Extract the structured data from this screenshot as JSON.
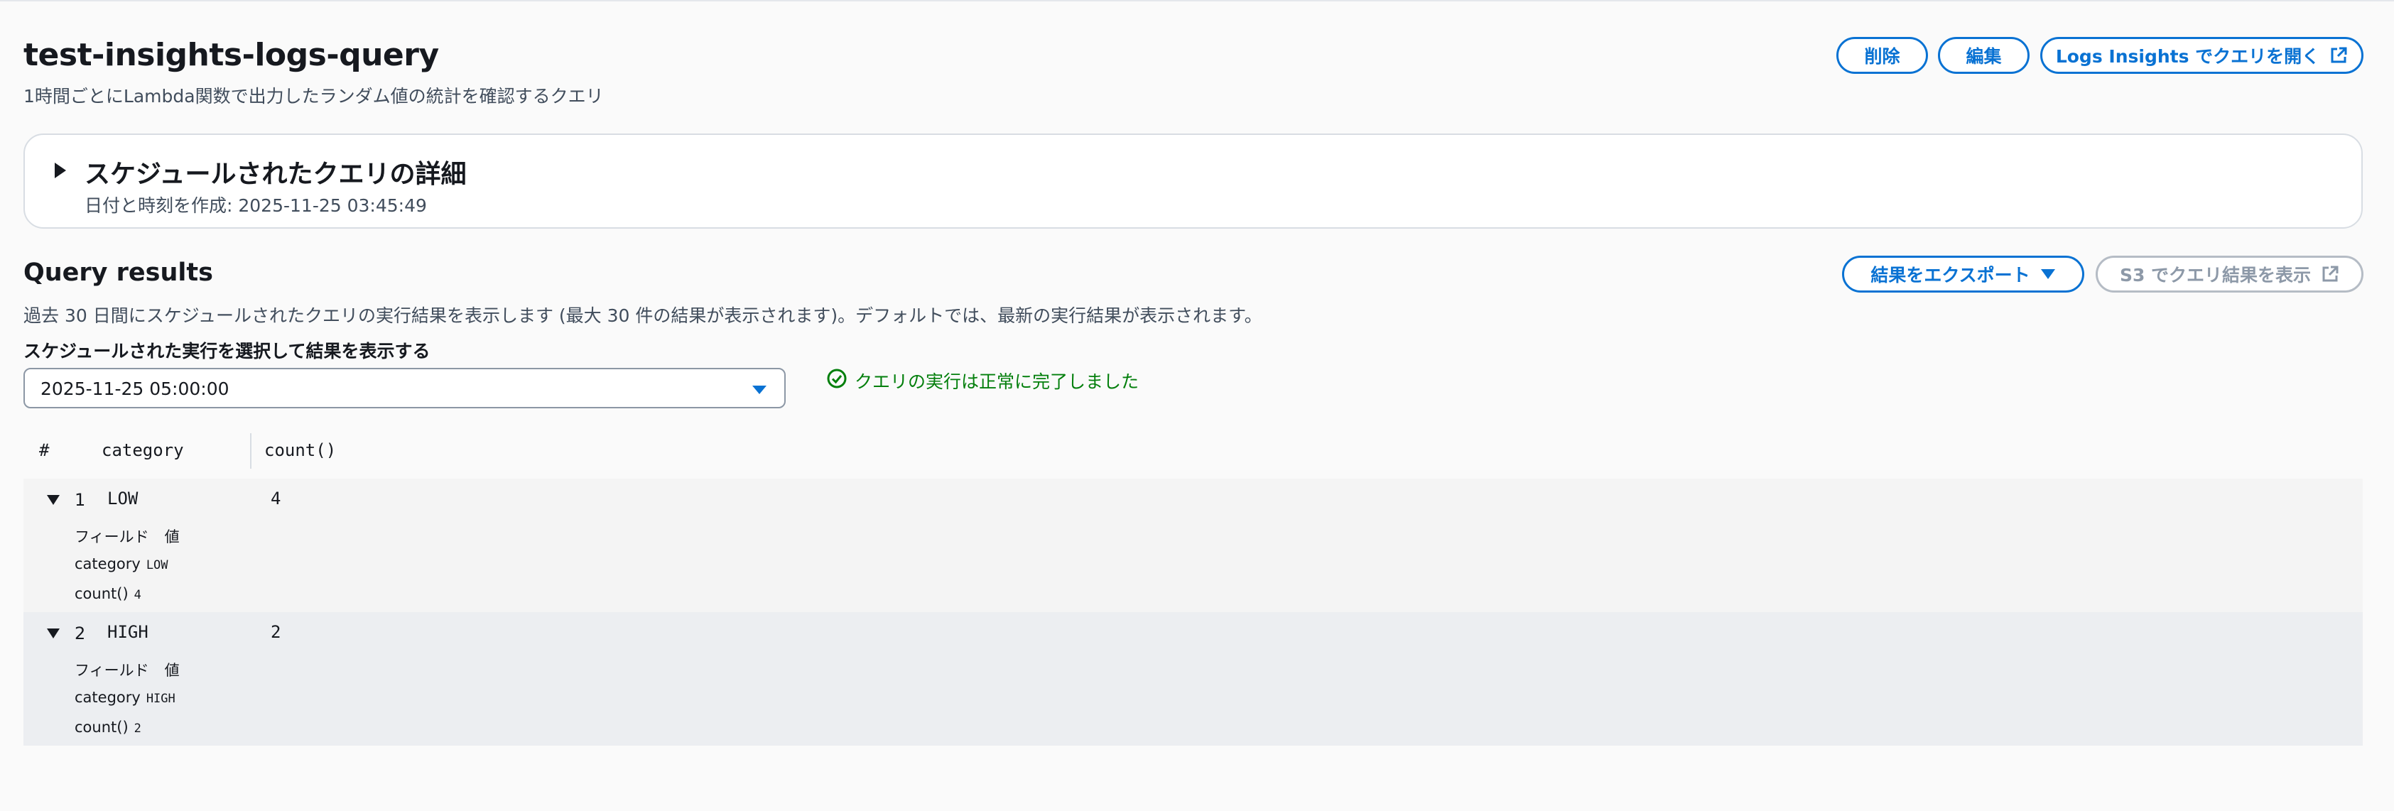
{
  "header": {
    "title": "test-insights-logs-query",
    "description": "1時間ごとにLambda関数で出力したランダム値の統計を確認するクエリ",
    "delete_label": "削除",
    "edit_label": "編集",
    "open_insights_label": "Logs Insights でクエリを開く"
  },
  "details": {
    "title": "スケジュールされたクエリの詳細",
    "created": "日付と時刻を作成: 2025-11-25 03:45:49"
  },
  "results": {
    "title": "Query results",
    "description": "過去 30 日間にスケジュールされたクエリの実行結果を表示します (最大 30 件の結果が表示されます)。デフォルトでは、最新の実行結果が表示されます。",
    "export_label": "結果をエクスポート",
    "s3_label": "S3 でクエリ結果を表示",
    "select_label": "スケジュールされた実行を選択して結果を表示する",
    "selected_run": "2025-11-25 05:00:00",
    "status_text": "クエリの実行は正常に完了しました"
  },
  "table": {
    "columns": [
      "#",
      "category",
      "count()"
    ],
    "field_header": "フィールド",
    "value_header": "値",
    "rows": [
      {
        "num": "1",
        "category": "LOW",
        "count": "4",
        "fields": [
          {
            "name": "category",
            "value": "LOW"
          },
          {
            "name": "count()",
            "value": "4"
          }
        ]
      },
      {
        "num": "2",
        "category": "HIGH",
        "count": "2",
        "fields": [
          {
            "name": "category",
            "value": "HIGH"
          },
          {
            "name": "count()",
            "value": "2"
          }
        ]
      }
    ]
  },
  "colors": {
    "accent": "#0972d3",
    "success": "#037f0c",
    "disabled": "#8d99a8"
  },
  "icons": [
    "external-link-icon",
    "caret-right-icon",
    "caret-down-icon",
    "dropdown-arrow-icon",
    "success-check-icon"
  ]
}
